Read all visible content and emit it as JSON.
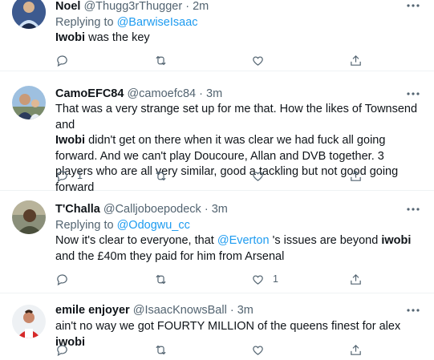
{
  "tweets": [
    {
      "name": "Noel",
      "handle": "@Thugg3rThugger",
      "time": "2m",
      "replying_label": "Replying to",
      "replying_to": "@BarwiseIsaac",
      "body_bold": "Iwobi",
      "body_rest": " was the key",
      "reply_count": "",
      "like_count": ""
    },
    {
      "name": "CamoEFC84",
      "handle": "@camoefc84",
      "time": "3m",
      "body_p1": "That was a very strange set up for me that. How the likes of Townsend and",
      "body_bold": "Iwobi",
      "body_p2": " didn't get on there when it was clear we had fuck all going forward. And we can't play Doucoure, Allan and DVB together. 3 players who are all very similar, good a tackling but not good going forward",
      "reply_count": "1",
      "like_count": ""
    },
    {
      "name": "T'Challa",
      "handle": "@Calljoboepodeck",
      "time": "3m",
      "replying_label": "Replying to",
      "replying_to": "@Odogwu_cc",
      "body_p1": "Now it's clear to everyone, that ",
      "body_mention": "@Everton",
      "body_p2": " 's issues are beyond ",
      "body_bold": "iwobi",
      "body_p3": " and the £40m they paid for him from Arsenal",
      "reply_count": "",
      "like_count": "1"
    },
    {
      "name": "emile enjoyer",
      "handle": "@IsaacKnowsBall",
      "time": "3m",
      "body_p1": "ain't no way we got FOURTY MILLION of the queens finest for alex ",
      "body_bold": "iwobi",
      "reply_count": "",
      "like_count": ""
    }
  ],
  "separator": "·",
  "icons": {
    "reply": "reply-icon",
    "retweet": "retweet-icon",
    "like": "heart-icon",
    "share": "share-icon",
    "more": "more-icon"
  },
  "colors": {
    "link": "#1d9bf0",
    "secondary": "#536471",
    "text": "#0f1419",
    "divider": "#eff3f4"
  }
}
